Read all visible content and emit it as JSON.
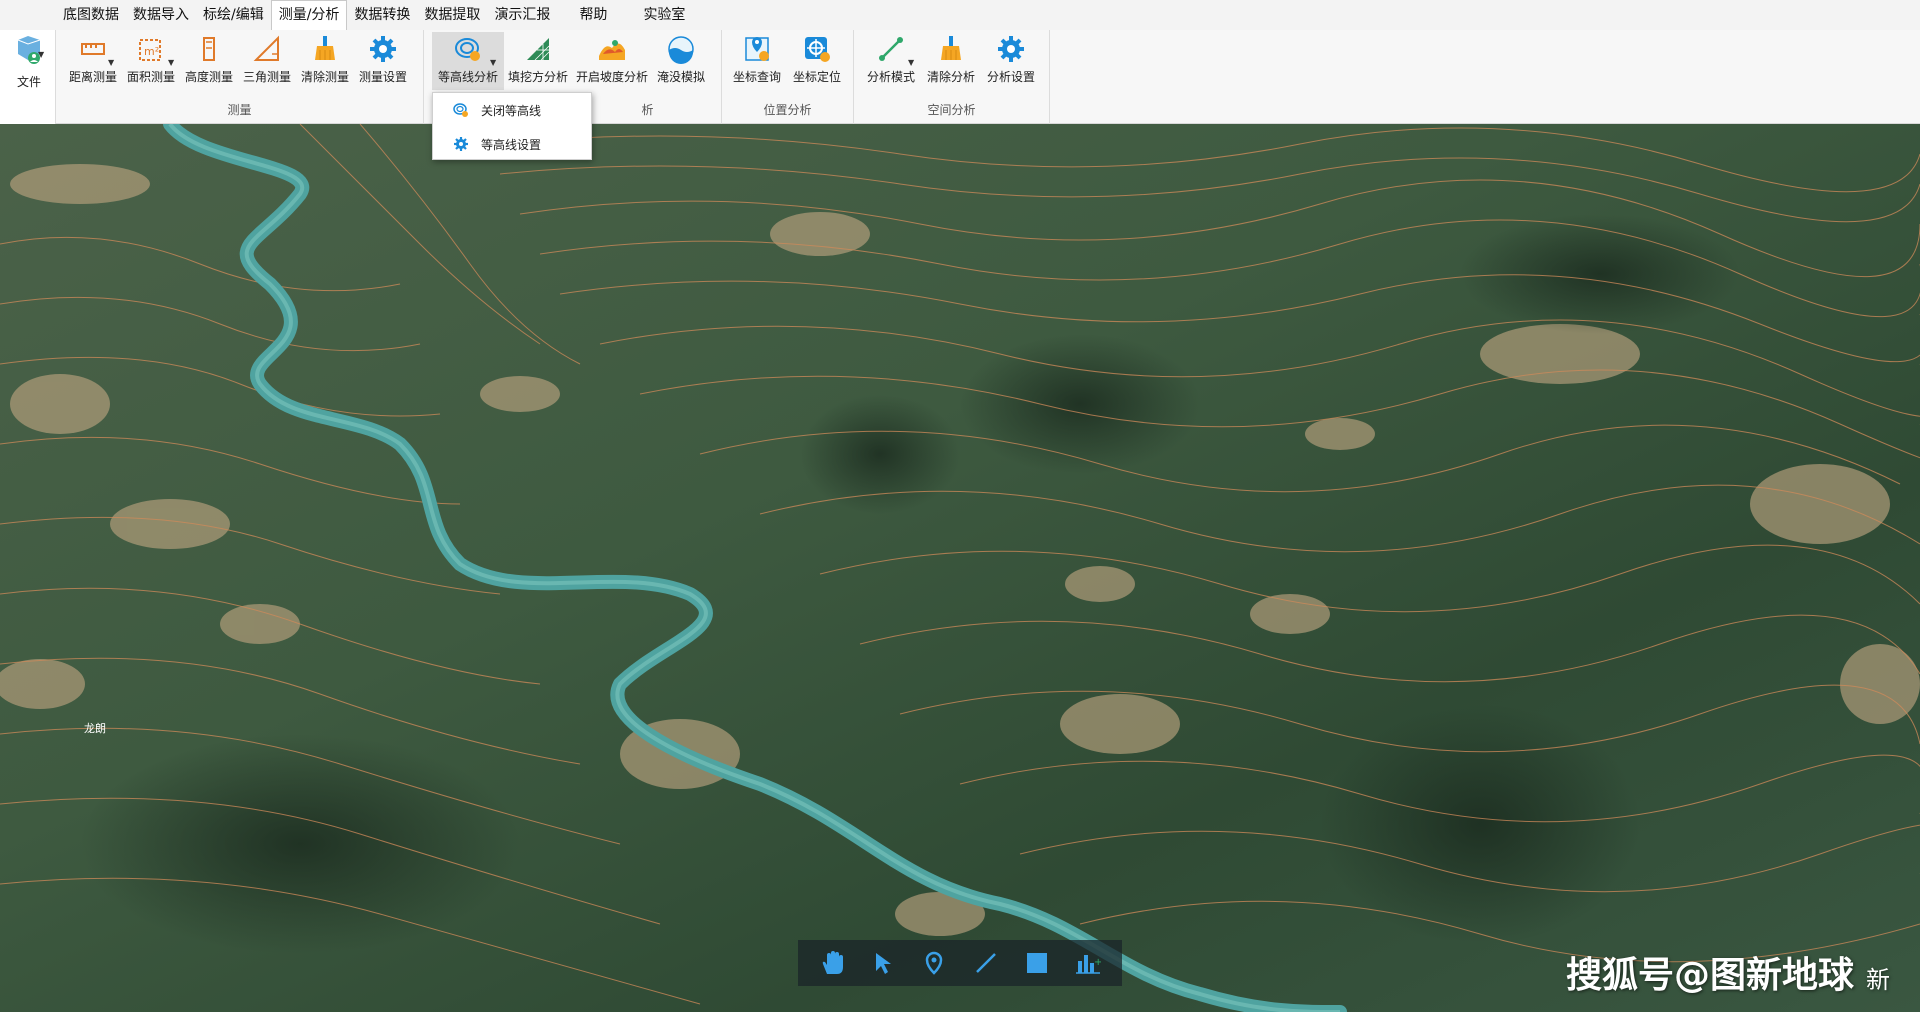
{
  "menu": {
    "items": [
      "底图数据",
      "数据导入",
      "标绘/编辑",
      "测量/分析",
      "数据转换",
      "数据提取",
      "演示汇报",
      "帮助",
      "实验室"
    ],
    "active_index": 3
  },
  "file": {
    "label": "文件"
  },
  "groups": {
    "measure": {
      "title": "测量",
      "tools": [
        "距离测量",
        "面积测量",
        "高度测量",
        "三角测量",
        "清除测量",
        "测量设置"
      ]
    },
    "analysis": {
      "title": "析",
      "tools": [
        "等高线分析",
        "填挖方分析",
        "开启坡度分析",
        "淹没模拟"
      ]
    },
    "location": {
      "title": "位置分析",
      "tools": [
        "坐标查询",
        "坐标定位"
      ]
    },
    "spatial": {
      "title": "空间分析",
      "tools": [
        "分析模式",
        "清除分析",
        "分析设置"
      ]
    }
  },
  "contour_menu": {
    "items": [
      "关闭等高线",
      "等高线设置"
    ]
  },
  "bottom_toolbar": {
    "tools": [
      "pan-hand-icon",
      "select-pointer-icon",
      "placemark-icon",
      "line-draw-icon",
      "polygon-draw-icon",
      "chart-add-icon"
    ]
  },
  "map_labels": {
    "village": "龙朗"
  },
  "watermark": {
    "main": "搜狐号@图新地球",
    "side": "新"
  },
  "colors": {
    "accent": "#1a8ad9",
    "contour": "#d08a5a",
    "river": "#4fa3a0",
    "ribbon_bg": "#f7f7f7"
  }
}
